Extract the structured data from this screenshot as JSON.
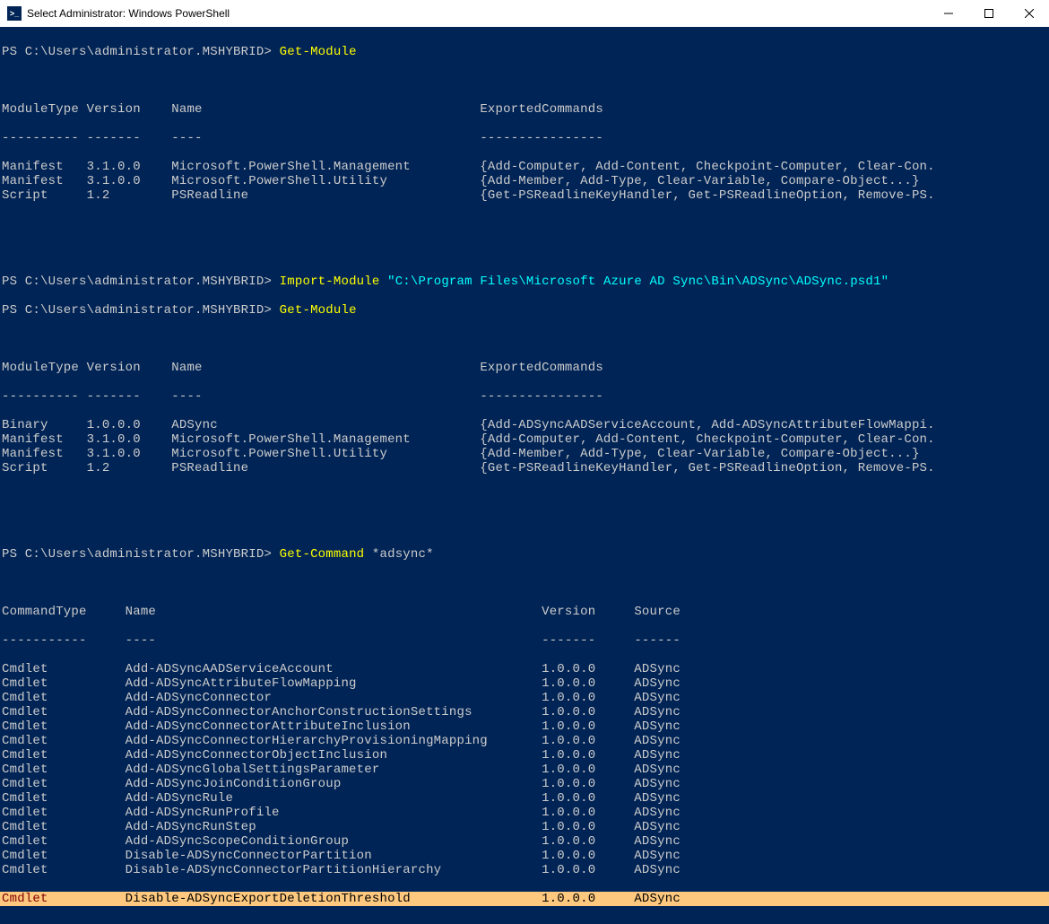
{
  "window": {
    "title": "Select Administrator: Windows PowerShell"
  },
  "blocks": {
    "prompt_path": "PS C:\\Users\\administrator.MSHYBRID>",
    "cmd1": "Get-Module",
    "modules1": {
      "header": {
        "c1": "ModuleType",
        "c2": "Version",
        "c3": "Name",
        "c4": "ExportedCommands"
      },
      "sep": {
        "c1": "----------",
        "c2": "-------",
        "c3": "----",
        "c4": "----------------"
      },
      "rows": [
        {
          "c1": "Manifest",
          "c2": "3.1.0.0",
          "c3": "Microsoft.PowerShell.Management",
          "c4": "{Add-Computer, Add-Content, Checkpoint-Computer, Clear-Con."
        },
        {
          "c1": "Manifest",
          "c2": "3.1.0.0",
          "c3": "Microsoft.PowerShell.Utility",
          "c4": "{Add-Member, Add-Type, Clear-Variable, Compare-Object...}"
        },
        {
          "c1": "Script",
          "c2": "1.2",
          "c3": "PSReadline",
          "c4": "{Get-PSReadlineKeyHandler, Get-PSReadlineOption, Remove-PS."
        }
      ]
    },
    "cmd2a": "Import-Module",
    "cmd2a_arg": "\"C:\\Program Files\\Microsoft Azure AD Sync\\Bin\\ADSync\\ADSync.psd1\"",
    "cmd2b": "Get-Module",
    "modules2": {
      "header": {
        "c1": "ModuleType",
        "c2": "Version",
        "c3": "Name",
        "c4": "ExportedCommands"
      },
      "sep": {
        "c1": "----------",
        "c2": "-------",
        "c3": "----",
        "c4": "----------------"
      },
      "rows": [
        {
          "c1": "Binary",
          "c2": "1.0.0.0",
          "c3": "ADSync",
          "c4": "{Add-ADSyncAADServiceAccount, Add-ADSyncAttributeFlowMappi."
        },
        {
          "c1": "Manifest",
          "c2": "3.1.0.0",
          "c3": "Microsoft.PowerShell.Management",
          "c4": "{Add-Computer, Add-Content, Checkpoint-Computer, Clear-Con."
        },
        {
          "c1": "Manifest",
          "c2": "3.1.0.0",
          "c3": "Microsoft.PowerShell.Utility",
          "c4": "{Add-Member, Add-Type, Clear-Variable, Compare-Object...}"
        },
        {
          "c1": "Script",
          "c2": "1.2",
          "c3": "PSReadline",
          "c4": "{Get-PSReadlineKeyHandler, Get-PSReadlineOption, Remove-PS."
        }
      ]
    },
    "cmd3": "Get-Command",
    "cmd3_arg": "*adsync*",
    "commands": {
      "header": {
        "c1": "CommandType",
        "c2": "Name",
        "c3": "Version",
        "c4": "Source"
      },
      "sep": {
        "c1": "-----------",
        "c2": "----",
        "c3": "-------",
        "c4": "------"
      },
      "rows": [
        {
          "c1": "Cmdlet",
          "c2": "Add-ADSyncAADServiceAccount",
          "c3": "1.0.0.0",
          "c4": "ADSync"
        },
        {
          "c1": "Cmdlet",
          "c2": "Add-ADSyncAttributeFlowMapping",
          "c3": "1.0.0.0",
          "c4": "ADSync"
        },
        {
          "c1": "Cmdlet",
          "c2": "Add-ADSyncConnector",
          "c3": "1.0.0.0",
          "c4": "ADSync"
        },
        {
          "c1": "Cmdlet",
          "c2": "Add-ADSyncConnectorAnchorConstructionSettings",
          "c3": "1.0.0.0",
          "c4": "ADSync"
        },
        {
          "c1": "Cmdlet",
          "c2": "Add-ADSyncConnectorAttributeInclusion",
          "c3": "1.0.0.0",
          "c4": "ADSync"
        },
        {
          "c1": "Cmdlet",
          "c2": "Add-ADSyncConnectorHierarchyProvisioningMapping",
          "c3": "1.0.0.0",
          "c4": "ADSync"
        },
        {
          "c1": "Cmdlet",
          "c2": "Add-ADSyncConnectorObjectInclusion",
          "c3": "1.0.0.0",
          "c4": "ADSync"
        },
        {
          "c1": "Cmdlet",
          "c2": "Add-ADSyncGlobalSettingsParameter",
          "c3": "1.0.0.0",
          "c4": "ADSync"
        },
        {
          "c1": "Cmdlet",
          "c2": "Add-ADSyncJoinConditionGroup",
          "c3": "1.0.0.0",
          "c4": "ADSync"
        },
        {
          "c1": "Cmdlet",
          "c2": "Add-ADSyncRule",
          "c3": "1.0.0.0",
          "c4": "ADSync"
        },
        {
          "c1": "Cmdlet",
          "c2": "Add-ADSyncRunProfile",
          "c3": "1.0.0.0",
          "c4": "ADSync"
        },
        {
          "c1": "Cmdlet",
          "c2": "Add-ADSyncRunStep",
          "c3": "1.0.0.0",
          "c4": "ADSync"
        },
        {
          "c1": "Cmdlet",
          "c2": "Add-ADSyncScopeConditionGroup",
          "c3": "1.0.0.0",
          "c4": "ADSync"
        },
        {
          "c1": "Cmdlet",
          "c2": "Disable-ADSyncConnectorPartition",
          "c3": "1.0.0.0",
          "c4": "ADSync"
        },
        {
          "c1": "Cmdlet",
          "c2": "Disable-ADSyncConnectorPartitionHierarchy",
          "c3": "1.0.0.0",
          "c4": "ADSync"
        }
      ],
      "highlighted": {
        "c1": "Cmdlet",
        "c2": "Disable-ADSyncExportDeletionThreshold",
        "c3": "1.0.0.0",
        "c4": "ADSync"
      }
    }
  }
}
